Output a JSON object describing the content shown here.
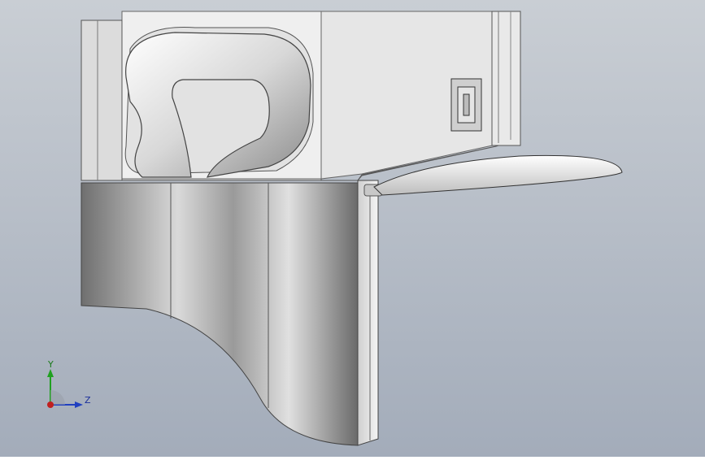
{
  "window": {
    "title": ""
  },
  "viewport": {
    "background_top": "#c8cdd3",
    "background_bottom": "#a6aebb",
    "model": "cad-part"
  },
  "triad": {
    "y_label": "Y",
    "z_label": "Z",
    "y_color": "#20a020",
    "z_color": "#2040c0",
    "x_color": "#c02020"
  }
}
